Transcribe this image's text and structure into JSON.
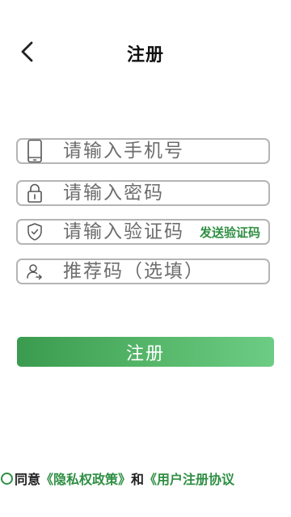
{
  "header": {
    "title": "注册"
  },
  "form": {
    "phone_placeholder": "请输入手机号",
    "password_placeholder": "请输入密码",
    "code_placeholder": "请输入验证码",
    "send_code_label": "发送验证码",
    "referral_placeholder": "推荐码（选填）"
  },
  "submit": {
    "label": "注册"
  },
  "agreement": {
    "agree_text": "同意",
    "privacy_link": "《隐私权政策》",
    "and_text": "和",
    "terms_link": "《用户注册协议"
  },
  "colors": {
    "accent": "#2f8f43",
    "border": "#b5b5b5"
  },
  "icons": [
    "back-arrow-icon",
    "phone-icon",
    "lock-icon",
    "shield-check-icon",
    "person-referral-icon"
  ]
}
